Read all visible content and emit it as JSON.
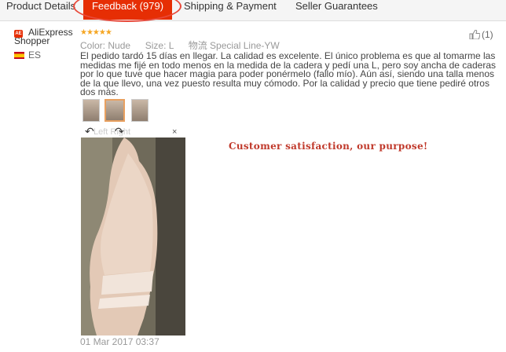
{
  "tabs": [
    {
      "label": "Product Details"
    },
    {
      "label": "Feedback (979)"
    },
    {
      "label": "Shipping & Payment"
    },
    {
      "label": "Seller Guarantees"
    }
  ],
  "reviewer": {
    "logo_text": "AE",
    "name": "AliExpress Shopper",
    "country": "ES"
  },
  "review": {
    "stars": "★★★★★",
    "color_label": "Color:",
    "color_value": "Nude",
    "size_label": "Size:",
    "size_value": "L",
    "shipping_label": "物流",
    "shipping_value": "Special Line-YW",
    "text": "El pedido tardó 15 días en llegar. La calidad es excelente. El único problema es que al tomarme las medidas me fijé en todo menos en la medida de la cadera y pedí una L, pero soy ancha de caderas por lo que tuve que hacer magia para poder ponérmelo (fallo mío). Aún así, siendo una talla menos de la que llevo, una vez puesto resulta muy cómodo. Por la calidad y precio que tiene pediré otros dos más.",
    "helpful_count": "(1)",
    "date": "01 Mar 2017 03:37"
  },
  "viewer": {
    "rotate_left": "↶",
    "rotate_right": "↷",
    "label": "Left Right",
    "close": "×"
  },
  "slogan": "Customer satisfaction, our purpose!",
  "icons": {
    "thumbs_up": "thumbs-up-icon",
    "flag": "spain-flag-icon"
  },
  "colors": {
    "accent": "#e62e04",
    "star": "#f5a623",
    "slogan": "#c0392b"
  }
}
